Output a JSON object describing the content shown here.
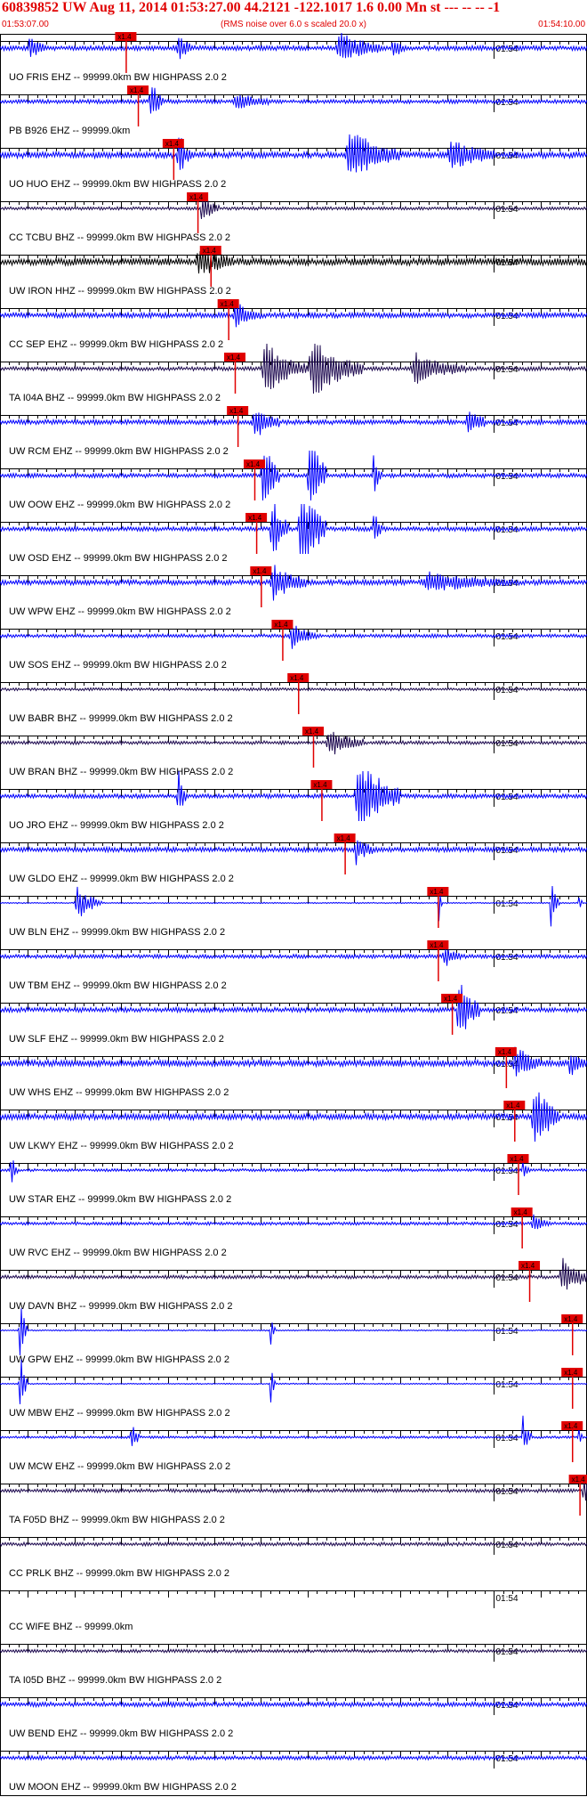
{
  "header": {
    "title": "60839852 UW Aug 11, 2014 01:53:27.00   44.2121 -122.1017  1.6 0.00 Mn st --- -- --   -1",
    "start_time": "01:53:07.00",
    "note": "(RMS noise over 6.0 s scaled 20.0 x)",
    "end_time": "01:54:10.00"
  },
  "colors": {
    "blue": "#0000ff",
    "dark": "#1e0a50",
    "black": "#000000",
    "pick": "#e00000"
  },
  "chart_data": {
    "type": "line",
    "title": "60839852 UW Aug 11, 2014 01:53:27.00   44.2121 -122.1017  1.6 0.00 Mn st --- -- --   -1",
    "x_range": [
      "01:53:07.00",
      "01:54:10.00"
    ],
    "minute_tick_label": "01:54",
    "pick_label": "x1.4",
    "series": [
      {
        "name": "UO FRIS EHZ -- 99999.0km BW  HIGHPASS  2.0  2",
        "color": "blue",
        "pick_s": 13.5,
        "amp": 1.2,
        "bursts": [
          [
            19,
            1.5,
            3
          ],
          [
            36,
            5,
            2.5
          ],
          [
            42,
            1.5,
            2
          ],
          [
            3,
            2,
            1.8
          ]
        ]
      },
      {
        "name": "PB B926 EHZ -- 99999.0km",
        "color": "blue",
        "pick_s": 14.8,
        "amp": 1.0,
        "bursts": [
          [
            16,
            1.5,
            4
          ],
          [
            25,
            4,
            1.5
          ]
        ]
      },
      {
        "name": "UO HUO EHZ -- 99999.0km BW  HIGHPASS  2.0  2",
        "color": "blue",
        "pick_s": 18.6,
        "amp": 1.6,
        "bursts": [
          [
            19,
            1.5,
            4
          ],
          [
            37,
            6,
            4
          ],
          [
            48,
            5,
            2.5
          ]
        ]
      },
      {
        "name": "CC TCBU BHZ -- 99999.0km BW  HIGHPASS  2.0  2",
        "color": "dark",
        "pick_s": 21.2,
        "amp": 0.8,
        "bursts": [
          [
            21.5,
            2,
            2.5
          ]
        ]
      },
      {
        "name": "UW IRON HHZ -- 99999.0km BW  HIGHPASS  2.0  2",
        "color": "black",
        "pick_s": 22.6,
        "amp": 1.8,
        "bursts": [
          [
            21,
            4,
            2.5
          ]
        ]
      },
      {
        "name": "CC SEP EHZ -- 99999.0km BW  HIGHPASS  2.0  2",
        "color": "blue",
        "pick_s": 24.5,
        "amp": 1.3,
        "bursts": [
          [
            25,
            3,
            2
          ]
        ]
      },
      {
        "name": "TA I04A BHZ -- 99999.0km BW  HIGHPASS  2.0  2",
        "color": "dark",
        "pick_s": 25.2,
        "amp": 1.0,
        "bursts": [
          [
            28,
            5,
            4.5
          ],
          [
            33,
            6,
            5
          ],
          [
            44,
            6,
            2.5
          ]
        ]
      },
      {
        "name": "UW RCM EHZ -- 99999.0km BW  HIGHPASS  2.0  2",
        "color": "blue",
        "pick_s": 25.5,
        "amp": 1.2,
        "bursts": [
          [
            27,
            3,
            3
          ],
          [
            50,
            2,
            3
          ]
        ]
      },
      {
        "name": "UW OOW EHZ -- 99999.0km BW  HIGHPASS  2.0  2",
        "color": "blue",
        "pick_s": 27.3,
        "amp": 1.1,
        "bursts": [
          [
            28,
            2,
            7
          ],
          [
            33,
            2,
            9
          ],
          [
            40,
            1,
            4
          ]
        ]
      },
      {
        "name": "UW OSD EHZ -- 99999.0km BW  HIGHPASS  2.0  2",
        "color": "blue",
        "pick_s": 27.5,
        "amp": 1.1,
        "bursts": [
          [
            29,
            2,
            6
          ],
          [
            32,
            3,
            9
          ],
          [
            40,
            1,
            4
          ]
        ]
      },
      {
        "name": "UW WPW EHZ -- 99999.0km BW  HIGHPASS  2.0  2",
        "color": "blue",
        "pick_s": 28.0,
        "amp": 1.3,
        "bursts": [
          [
            29,
            4,
            3
          ],
          [
            45,
            10,
            1.5
          ]
        ]
      },
      {
        "name": "UW SOS EHZ -- 99999.0km BW  HIGHPASS  2.0  2",
        "color": "blue",
        "pick_s": 30.3,
        "amp": 0.9,
        "bursts": [
          [
            31,
            3,
            2
          ]
        ]
      },
      {
        "name": "UW BABR BHZ -- 99999.0km BW  HIGHPASS  2.0  2",
        "color": "dark",
        "pick_s": 32.0,
        "amp": 0.7,
        "bursts": []
      },
      {
        "name": "UW BRAN BHZ -- 99999.0km BW  HIGHPASS  2.0  2",
        "color": "dark",
        "pick_s": 33.6,
        "amp": 0.9,
        "bursts": [
          [
            35,
            4,
            2.5
          ],
          [
            63,
            2,
            2
          ]
        ]
      },
      {
        "name": "UO JRO EHZ -- 99999.0km BW  HIGHPASS  2.0  2",
        "color": "blue",
        "pick_s": 34.5,
        "amp": 1.1,
        "bursts": [
          [
            19,
            1,
            5
          ],
          [
            38,
            5,
            7
          ]
        ]
      },
      {
        "name": "UW GLDO EHZ -- 99999.0km BW  HIGHPASS  2.0  2",
        "color": "blue",
        "pick_s": 37.0,
        "amp": 1.2,
        "bursts": [
          [
            38,
            2,
            2.5
          ]
        ]
      },
      {
        "name": "UW BLN EHZ -- 99999.0km BW  HIGHPASS  2.0  2",
        "color": "blue",
        "pick_s": 47.0,
        "amp": 0.3,
        "bursts": [
          [
            8,
            3,
            3
          ],
          [
            47,
            0.5,
            4
          ],
          [
            59,
            1,
            4
          ],
          [
            62,
            0.5,
            3
          ]
        ]
      },
      {
        "name": "UW TBM EHZ -- 99999.0km BW  HIGHPASS  2.0  2",
        "color": "blue",
        "pick_s": 47.0,
        "amp": 1.0,
        "bursts": [
          [
            47.5,
            2,
            1.8
          ]
        ]
      },
      {
        "name": "UW SLF EHZ -- 99999.0km BW  HIGHPASS  2.0  2",
        "color": "blue",
        "pick_s": 48.5,
        "amp": 1.2,
        "bursts": [
          [
            49,
            2.5,
            6
          ]
        ]
      },
      {
        "name": "UW WHS EHZ -- 99999.0km BW  HIGHPASS  2.0  2",
        "color": "blue",
        "pick_s": 54.3,
        "amp": 1.6,
        "bursts": [
          [
            55,
            3,
            3
          ],
          [
            61,
            2,
            2
          ]
        ]
      },
      {
        "name": "UW LKWY EHZ -- 99999.0km BW  HIGHPASS  2.0  2",
        "color": "blue",
        "pick_s": 55.2,
        "amp": 1.6,
        "bursts": [
          [
            57,
            3,
            6
          ]
        ]
      },
      {
        "name": "UW STAR EHZ -- 99999.0km BW  HIGHPASS  2.0  2",
        "color": "blue",
        "pick_s": 55.6,
        "amp": 0.7,
        "bursts": [
          [
            1,
            1,
            3
          ],
          [
            56,
            1,
            1.5
          ]
        ]
      },
      {
        "name": "UW RVC EHZ -- 99999.0km BW  HIGHPASS  2.0  2",
        "color": "blue",
        "pick_s": 56.0,
        "amp": 0.8,
        "bursts": [
          [
            57,
            2,
            1.5
          ]
        ]
      },
      {
        "name": "UW DAVN BHZ -- 99999.0km BW  HIGHPASS  2.0  2",
        "color": "dark",
        "pick_s": 56.8,
        "amp": 0.9,
        "bursts": [
          [
            60,
            4,
            3
          ]
        ]
      },
      {
        "name": "UW GPW EHZ -- 99999.0km BW  HIGHPASS  2.0  2",
        "color": "blue",
        "pick_s": 61.4,
        "amp": 0.3,
        "bursts": [
          [
            2,
            1,
            6
          ],
          [
            29,
            0.5,
            4
          ]
        ]
      },
      {
        "name": "UW MBW EHZ -- 99999.0km BW  HIGHPASS  2.0  2",
        "color": "blue",
        "pick_s": 61.4,
        "amp": 0.3,
        "bursts": [
          [
            2,
            1,
            6
          ],
          [
            29,
            0.5,
            5
          ]
        ]
      },
      {
        "name": "UW MCW EHZ -- 99999.0km BW  HIGHPASS  2.0  2",
        "color": "blue",
        "pick_s": 61.4,
        "amp": 0.6,
        "bursts": [
          [
            14,
            1,
            3
          ],
          [
            56,
            1,
            4
          ],
          [
            62,
            0.5,
            3
          ]
        ]
      },
      {
        "name": "TA F05D BHZ -- 99999.0km BW  HIGHPASS  2.0  2",
        "color": "dark",
        "pick_s": 62.2,
        "amp": 0.9,
        "bursts": [
          [
            62.5,
            1,
            3
          ]
        ]
      },
      {
        "name": "CC PRLK BHZ -- 99999.0km BW  HIGHPASS  2.0  2",
        "color": "dark",
        "pick_s": null,
        "amp": 0.9,
        "bursts": []
      },
      {
        "name": "CC WIFE BHZ -- 99999.0km",
        "color": "dark",
        "pick_s": null,
        "amp": 0,
        "bursts": []
      },
      {
        "name": "TA I05D BHZ -- 99999.0km BW  HIGHPASS  2.0  2",
        "color": "dark",
        "pick_s": null,
        "amp": 0.8,
        "bursts": []
      },
      {
        "name": "UW BEND EHZ -- 99999.0km BW  HIGHPASS  2.0  2",
        "color": "blue",
        "pick_s": null,
        "amp": 1.2,
        "bursts": [
          [
            64,
            1,
            1.5
          ]
        ]
      },
      {
        "name": "UW MOON EHZ -- 99999.0km BW  HIGHPASS  2.0  2",
        "color": "blue",
        "pick_s": null,
        "amp": 1.0,
        "bursts": []
      }
    ]
  }
}
